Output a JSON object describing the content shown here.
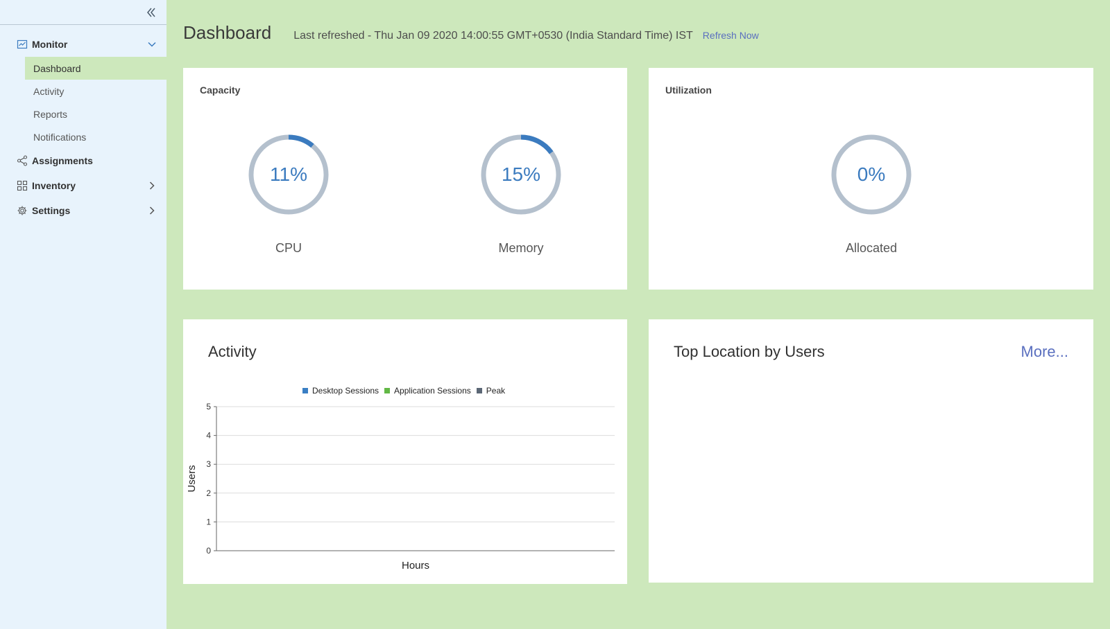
{
  "sidebar": {
    "collapse_icon": "double-chevron-left-icon",
    "groups": [
      {
        "label": "Monitor",
        "icon": "monitor-chart-icon",
        "chevron": "chevron-down-icon"
      },
      {
        "label": "Assignments",
        "icon": "share-nodes-icon"
      },
      {
        "label": "Inventory",
        "icon": "grid-icon",
        "chevron": "chevron-right-icon"
      },
      {
        "label": "Settings",
        "icon": "gear-icon",
        "chevron": "chevron-right-icon"
      }
    ],
    "monitor_items": [
      {
        "label": "Dashboard",
        "active": true
      },
      {
        "label": "Activity"
      },
      {
        "label": "Reports"
      },
      {
        "label": "Notifications"
      }
    ]
  },
  "header": {
    "title": "Dashboard",
    "last_refreshed": "Last refreshed - Thu Jan 09 2020 14:00:55 GMT+0530 (India Standard Time) IST",
    "refresh_label": "Refresh Now"
  },
  "capacity": {
    "title": "Capacity",
    "cpu": {
      "value_text": "11%",
      "value": 11,
      "label": "CPU"
    },
    "memory": {
      "value_text": "15%",
      "value": 15,
      "label": "Memory"
    }
  },
  "utilization": {
    "title": "Utilization",
    "allocated": {
      "value_text": "0%",
      "value": 0,
      "label": "Allocated"
    }
  },
  "activity": {
    "title": "Activity",
    "legend": [
      {
        "name": "Desktop Sessions",
        "color": "#3a7fc4"
      },
      {
        "name": "Application Sessions",
        "color": "#62b845"
      },
      {
        "name": "Peak",
        "color": "#5b6775"
      }
    ]
  },
  "top_location": {
    "title": "Top Location by Users",
    "more_label": "More..."
  },
  "colors": {
    "gauge_track": "#b4c0cd",
    "gauge_fill": "#3b7bbf",
    "accent_link": "#5a6fbf",
    "background": "#cde8bc"
  },
  "chart_data": {
    "type": "line",
    "title": "Activity",
    "xlabel": "Hours",
    "ylabel": "Users",
    "ylim": [
      0,
      5
    ],
    "yticks": [
      0,
      1,
      2,
      3,
      4,
      5
    ],
    "series": [
      {
        "name": "Desktop Sessions",
        "values": []
      },
      {
        "name": "Application Sessions",
        "values": []
      },
      {
        "name": "Peak",
        "values": []
      }
    ],
    "grid": true,
    "legend_position": "top"
  }
}
